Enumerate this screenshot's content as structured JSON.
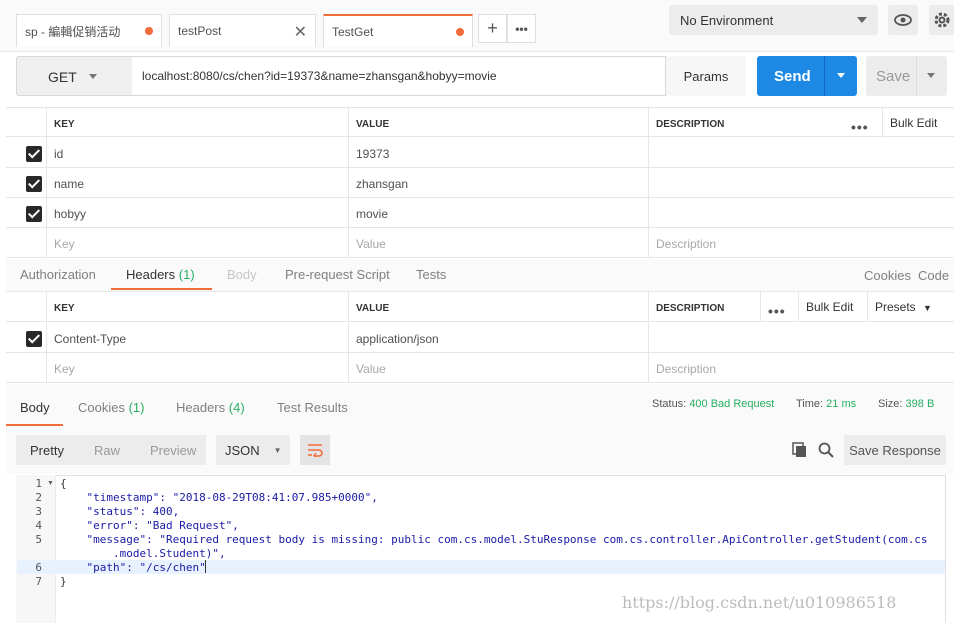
{
  "tabs": [
    {
      "label": "sp - 編輯促销活动",
      "state": "dot"
    },
    {
      "label": "testPost",
      "state": "close"
    },
    {
      "label": "TestGet",
      "state": "dot"
    }
  ],
  "environment": {
    "selected": "No Environment"
  },
  "request": {
    "method": "GET",
    "url": "localhost:8080/cs/chen?id=19373&name=zhansgan&hobyy=movie",
    "params_label": "Params",
    "send_label": "Send",
    "save_label": "Save"
  },
  "params_table": {
    "headers": {
      "key": "KEY",
      "value": "VALUE",
      "description": "DESCRIPTION",
      "bulk_edit": "Bulk Edit",
      "more": "•••"
    },
    "rows": [
      {
        "key": "id",
        "value": "19373"
      },
      {
        "key": "name",
        "value": "zhansgan"
      },
      {
        "key": "hobyy",
        "value": "movie"
      }
    ],
    "placeholders": {
      "key": "Key",
      "value": "Value",
      "description": "Description"
    }
  },
  "request_tabs": {
    "authorization": "Authorization",
    "headers": "Headers",
    "headers_count": "(1)",
    "body": "Body",
    "prerequest": "Pre-request Script",
    "tests": "Tests",
    "cookies": "Cookies",
    "code": "Code"
  },
  "headers_table": {
    "headers": {
      "key": "KEY",
      "value": "VALUE",
      "description": "DESCRIPTION",
      "bulk_edit": "Bulk Edit",
      "presets": "Presets",
      "more": "•••"
    },
    "rows": [
      {
        "key": "Content-Type",
        "value": "application/json"
      }
    ],
    "placeholders": {
      "key": "Key",
      "value": "Value",
      "description": "Description"
    }
  },
  "response_tabs": {
    "body": "Body",
    "cookies": "Cookies",
    "cookies_count": "(1)",
    "headers": "Headers",
    "headers_count": "(4)",
    "test_results": "Test Results"
  },
  "response_meta": {
    "status_label": "Status:",
    "status_value": "400 Bad Request",
    "time_label": "Time:",
    "time_value": "21 ms",
    "size_label": "Size:",
    "size_value": "398 B"
  },
  "view": {
    "pretty": "Pretty",
    "raw": "Raw",
    "preview": "Preview",
    "format": "JSON",
    "save_response": "Save Response"
  },
  "code_lines": [
    {
      "n": "1",
      "text": "{"
    },
    {
      "n": "2",
      "text": "    \"timestamp\": \"2018-08-29T08:41:07.985+0000\","
    },
    {
      "n": "3",
      "text": "    \"status\": 400,"
    },
    {
      "n": "4",
      "text": "    \"error\": \"Bad Request\","
    },
    {
      "n": "5",
      "text": "    \"message\": \"Required request body is missing: public com.cs.model.StuResponse com.cs.controller.ApiController.getStudent(com.cs"
    },
    {
      "n": "",
      "text": "        .model.Student)\","
    },
    {
      "n": "6",
      "text": "    \"path\": \"/cs/chen\""
    },
    {
      "n": "7",
      "text": "}"
    }
  ],
  "watermark": "https://blog.csdn.net/u010986518",
  "colors": {
    "accent": "#f26b3a",
    "send": "#1e88e5",
    "status": "#27ae60"
  }
}
